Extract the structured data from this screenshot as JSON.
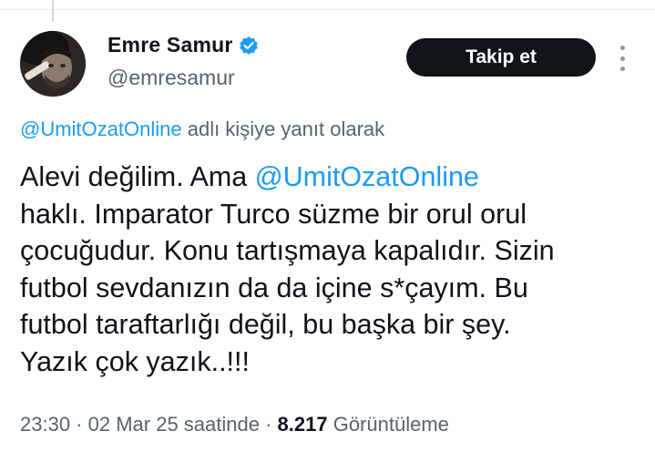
{
  "author": {
    "display_name": "Emre Samur",
    "handle": "@emresamur",
    "verified": true,
    "verified_color": "#1d9bf0"
  },
  "actions": {
    "follow_label": "Takip et",
    "more_icon": "more-vertical-icon"
  },
  "reply_context": {
    "mention": "@UmitOzatOnline",
    "suffix": " adlı kişiye yanıt olarak"
  },
  "tweet": {
    "line1_prefix": "Alevi değilim. Ama ",
    "line1_mention": "@UmitOzatOnline",
    "line2": "haklı.  Imparator Turco süzme bir orul orul",
    "line3": "çocuğudur.  Konu tartışmaya kapalıdır. Sizin",
    "line4": "futbol sevdanızın da da içine s*çayım. Bu",
    "line5": "futbol taraftarlığı değil, bu başka bir şey.",
    "line6": "Yazık çok yazık..!!!"
  },
  "meta": {
    "time": "23:30",
    "separator": " · ",
    "date": "02 Mar 25 saatinde",
    "separator2": " · ",
    "views_count": "8.217",
    "views_label": " Görüntüleme"
  },
  "colors": {
    "text": "#0f1419",
    "muted": "#536471",
    "link": "#1d9bf0",
    "button_bg": "#0f1419"
  }
}
